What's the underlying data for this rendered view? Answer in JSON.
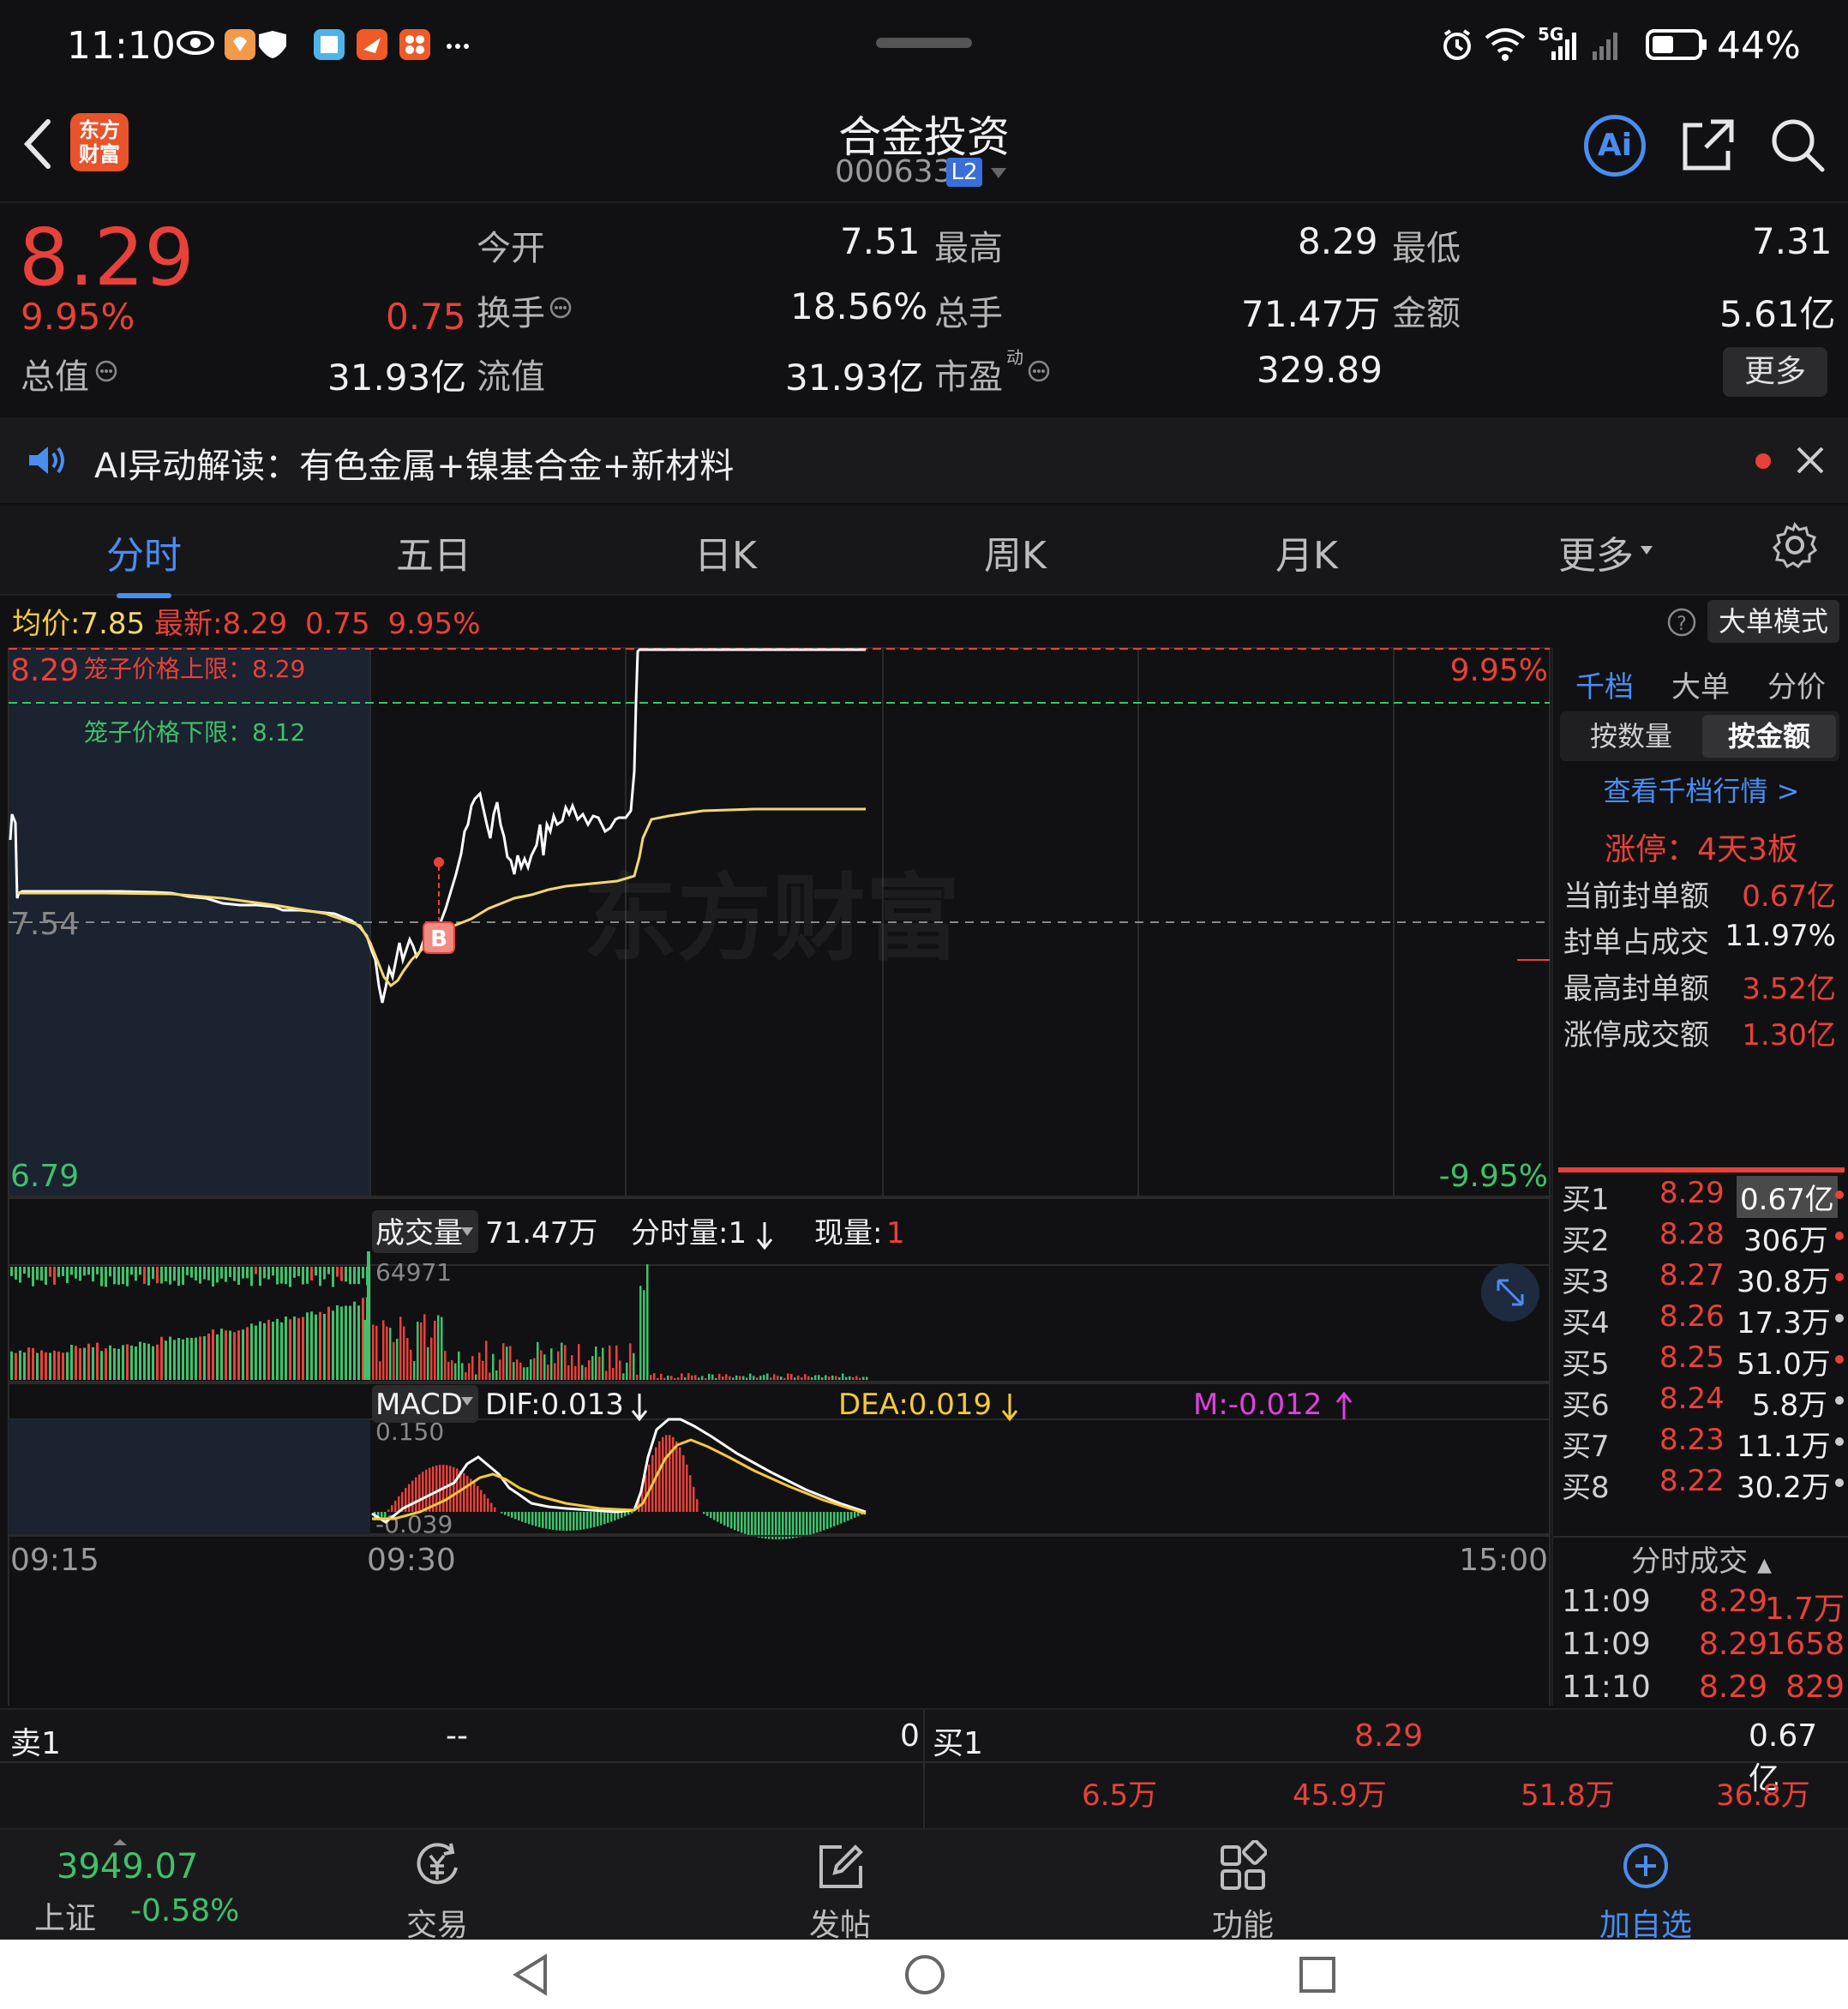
{
  "status": {
    "time": "11:10",
    "signal": "5G",
    "battery": "44%"
  },
  "header": {
    "logo_text_line1": "东方",
    "logo_text_line2": "财富",
    "stock_name": "合金投资",
    "stock_code": "000633",
    "level_badge": "L2",
    "ai_label": "Ai"
  },
  "quote": {
    "price": "8.29",
    "change_pct": "9.95%",
    "change": "0.75",
    "total_value_label": "总值",
    "total_value": "31.93亿",
    "open_label": "今开",
    "open": "7.51",
    "high_label": "最高",
    "high": "8.29",
    "low_label": "最低",
    "low": "7.31",
    "turnover_label": "换手",
    "turnover": "18.56%",
    "volume_label": "总手",
    "volume": "71.47万",
    "amount_label": "金额",
    "amount": "5.61亿",
    "float_label": "流值",
    "float_value": "31.93亿",
    "pe_label": "市盈",
    "pe_sup": "动",
    "pe": "329.89",
    "more": "更多"
  },
  "alert": {
    "text": "AI异动解读：有色金属+镍基合金+新材料"
  },
  "tabs": [
    "分时",
    "五日",
    "日K",
    "周K",
    "月K",
    "更多"
  ],
  "chart_info": {
    "avg_label": "均价:",
    "avg": "7.85",
    "latest_label": "最新:",
    "latest": "8.29",
    "change": "0.75",
    "pct": "9.95%",
    "big_order_mode": "大单模式"
  },
  "price_chart": {
    "top_price": "8.29",
    "cage_upper": "笼子价格上限：8.29",
    "cage_lower": "笼子价格下限：8.12",
    "prev_close": "7.54",
    "bottom_price": "6.79",
    "top_pct": "9.95%",
    "bottom_pct": "-9.95%",
    "buy_marker": "B",
    "watermark": "东方财富"
  },
  "volume_panel": {
    "selector": "成交量",
    "total": "71.47万",
    "tick_label": "分时量:1",
    "current_label": "现量:",
    "current": "1",
    "max_label": "64971"
  },
  "macd_panel": {
    "selector": "MACD",
    "dif": "DIF:0.013",
    "dea": "DEA:0.019",
    "m": "M:-0.012",
    "top_label": "0.150",
    "bottom_label": "-0.039"
  },
  "time_axis": [
    "09:15",
    "09:30",
    "15:00"
  ],
  "side": {
    "tabs": [
      "千档",
      "大单",
      "分价"
    ],
    "toggle": [
      "按数量",
      "按金额"
    ],
    "view_link": "查看千档行情 >",
    "limit_title": "涨停：4天3板",
    "stats": [
      {
        "label": "当前封单额",
        "value": "0.67亿"
      },
      {
        "label": "封单占成交",
        "value": "11.97%"
      },
      {
        "label": "最高封单额",
        "value": "3.52亿"
      },
      {
        "label": "涨停成交额",
        "value": "1.30亿"
      }
    ],
    "bids": [
      {
        "level": "买1",
        "price": "8.29",
        "amount": "0.67亿"
      },
      {
        "level": "买2",
        "price": "8.28",
        "amount": "306万"
      },
      {
        "level": "买3",
        "price": "8.27",
        "amount": "30.8万"
      },
      {
        "level": "买4",
        "price": "8.26",
        "amount": "17.3万"
      },
      {
        "level": "买5",
        "price": "8.25",
        "amount": "51.0万"
      },
      {
        "level": "买6",
        "price": "8.24",
        "amount": "5.8万"
      },
      {
        "level": "买7",
        "price": "8.23",
        "amount": "11.1万"
      },
      {
        "level": "买8",
        "price": "8.22",
        "amount": "30.2万"
      }
    ],
    "ticks_title": "分时成交",
    "ticks": [
      {
        "time": "11:09",
        "price": "8.29",
        "vol": "1.7万"
      },
      {
        "time": "11:09",
        "price": "8.29",
        "vol": "1658"
      },
      {
        "time": "11:10",
        "price": "8.29",
        "vol": "829"
      }
    ]
  },
  "orderbook_bottom": {
    "sell_label": "卖1",
    "sell_price": "--",
    "sell_vol": "0",
    "buy_label": "买1",
    "buy_price": "8.29",
    "buy_amount": "0.67亿",
    "queue": [
      "6.5万",
      "45.9万",
      "51.8万",
      "36.8万"
    ]
  },
  "nav": {
    "index_value": "3949.07",
    "index_name": "上证",
    "index_pct": "-0.58%",
    "items": [
      "交易",
      "发帖",
      "功能",
      "加自选"
    ]
  },
  "colors": {
    "up": "#e8413a",
    "down": "#3ec26b",
    "accent": "#4a8df0",
    "avg_line": "#f5d76e",
    "price_line": "#ffffff",
    "dea_line": "#f5c93c",
    "m_color": "#e040e0"
  }
}
